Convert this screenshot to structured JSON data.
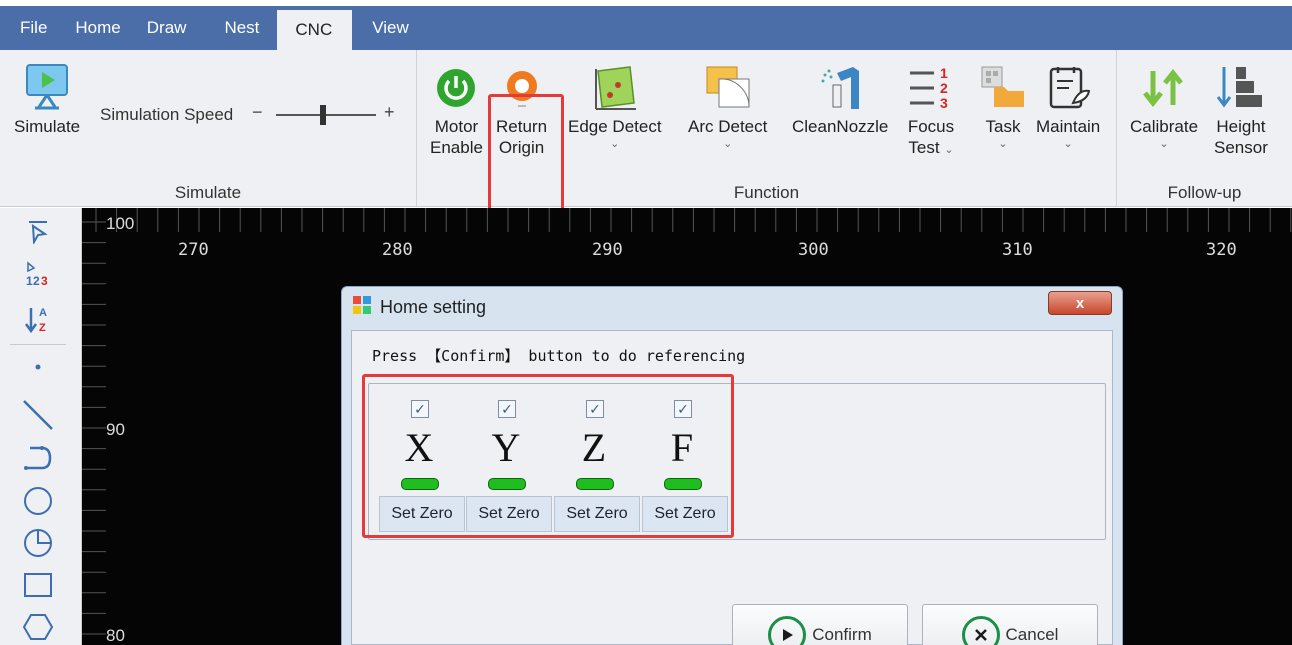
{
  "menu": {
    "tabs": [
      "File",
      "Home",
      "Draw",
      "Nest",
      "CNC",
      "View"
    ],
    "active": "CNC"
  },
  "ribbon": {
    "simulate_group": {
      "label": "Simulate",
      "simulate_button": "Simulate",
      "speed_label": "Simulation Speed",
      "speed_minus": "−",
      "speed_plus": "+"
    },
    "function_group": {
      "label": "Function",
      "motor_enable": [
        "Motor",
        "Enable"
      ],
      "return_origin": [
        "Return",
        "Origin"
      ],
      "edge_detect": "Edge Detect",
      "arc_detect": "Arc Detect",
      "clean_nozzle": "CleanNozzle",
      "focus_test": [
        "Focus",
        "Test"
      ],
      "task": "Task",
      "maintain": "Maintain"
    },
    "followup_group": {
      "label": "Follow-up",
      "calibrate": "Calibrate",
      "height_sensor": [
        "Height",
        "Sensor"
      ]
    }
  },
  "canvas": {
    "x_ticks": [
      "270",
      "280",
      "290",
      "300",
      "310",
      "320"
    ],
    "y_ticks": [
      "100",
      "90",
      "80"
    ]
  },
  "dialog": {
    "title": "Home setting",
    "close": "x",
    "instruction": "Press 【Confirm】 button to do referencing",
    "axes": [
      {
        "name": "X",
        "checked": true,
        "set_zero": "Set Zero"
      },
      {
        "name": "Y",
        "checked": true,
        "set_zero": "Set Zero"
      },
      {
        "name": "Z",
        "checked": true,
        "set_zero": "Set Zero"
      },
      {
        "name": "F",
        "checked": true,
        "set_zero": "Set Zero"
      }
    ],
    "confirm": "Confirm",
    "cancel": "Cancel"
  },
  "colors": {
    "menubar": "#4b6ea9",
    "highlight": "#e43a3a",
    "status_led": "#1fbd1f",
    "accent_green": "#1b8f45"
  }
}
